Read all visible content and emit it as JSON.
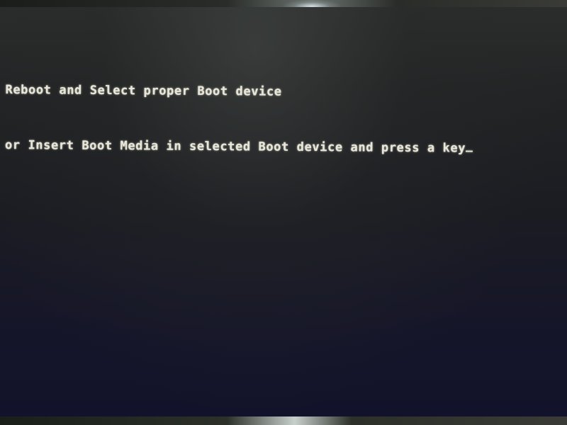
{
  "screen": {
    "type": "bios-boot-error",
    "lines": [
      "Reboot and Select proper Boot device",
      "or Insert Boot Media in selected Boot device and press a key"
    ],
    "cursor": "_",
    "colors": {
      "text": "#e8e6d8",
      "background": "#1b1c22"
    }
  }
}
